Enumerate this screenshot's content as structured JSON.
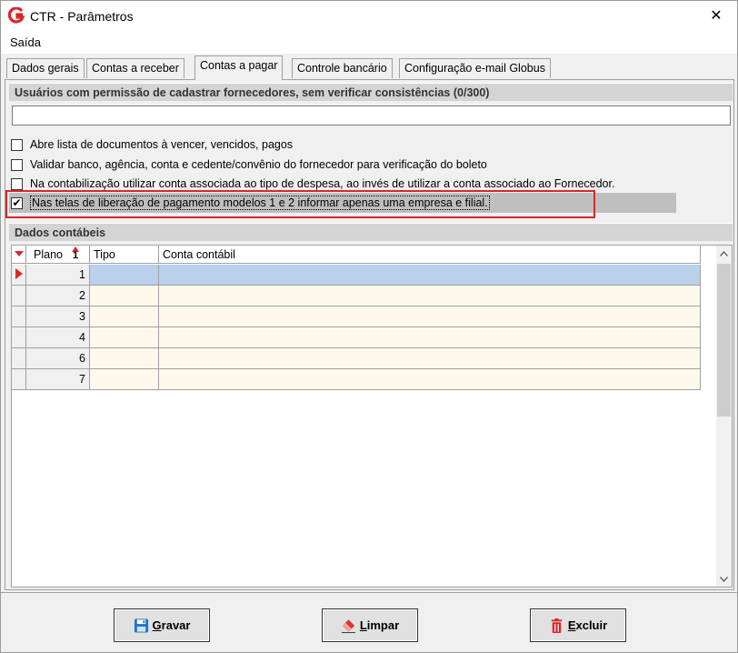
{
  "window": {
    "title": "CTR - Parâmetros",
    "close": "✕"
  },
  "menu": {
    "item": "Saída"
  },
  "tabs": [
    "Dados gerais",
    "Contas a receber",
    "Contas a pagar",
    "Controle bancário",
    "Configuração e-mail Globus"
  ],
  "section1": {
    "header": "Usuários com permissão de cadastrar fornecedores, sem verificar consistências (0/300)",
    "value": ""
  },
  "options": [
    {
      "label": "Abre lista de documentos à vencer, vencidos, pagos",
      "checked": false
    },
    {
      "label": "Validar banco, agência, conta e cedente/convênio do fornecedor para verificação do boleto",
      "checked": false
    },
    {
      "label": "Na contabilização utilizar conta associada ao tipo de despesa, ao  invés de utilizar a conta associado ao Fornecedor.",
      "checked": false
    },
    {
      "label": "Nas telas de liberação de pagamento modelos 1 e 2 informar apenas uma empresa e filial.",
      "checked": true
    }
  ],
  "section2": {
    "header": "Dados contábeis"
  },
  "grid": {
    "columns": {
      "plano": "Plano",
      "sort_mark": "1",
      "tipo": "Tipo",
      "conta": "Conta contábil"
    },
    "rows": [
      {
        "plano": "1",
        "tipo": "",
        "conta": ""
      },
      {
        "plano": "2",
        "tipo": "",
        "conta": ""
      },
      {
        "plano": "3",
        "tipo": "",
        "conta": ""
      },
      {
        "plano": "4",
        "tipo": "",
        "conta": ""
      },
      {
        "plano": "6",
        "tipo": "",
        "conta": ""
      },
      {
        "plano": "7",
        "tipo": "",
        "conta": ""
      }
    ]
  },
  "buttons": {
    "gravar": {
      "hot": "G",
      "rest": "ravar"
    },
    "limpar": {
      "hot": "L",
      "rest": "impar"
    },
    "excluir": {
      "hot": "E",
      "rest": "xcluir"
    }
  },
  "colors": {
    "highlight": "#d9262b",
    "selected_row": "#b9d1ea",
    "grid_cell": "#fef9ec"
  }
}
